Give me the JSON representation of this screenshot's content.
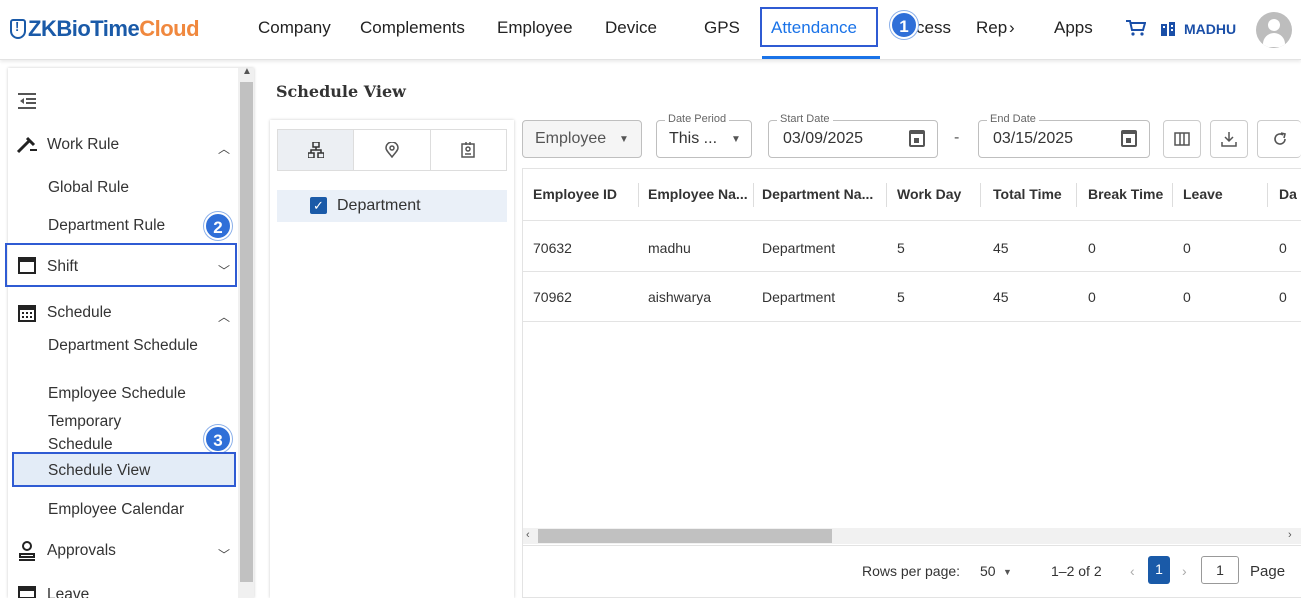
{
  "app": {
    "logo_zk": "ZKBioTime",
    "logo_cloud": "Cloud"
  },
  "nav": {
    "items": [
      "Company",
      "Complements",
      "Employee",
      "Device",
      "GPS",
      "Attendance",
      "cess",
      "Rep",
      "Apps"
    ],
    "active": "Attendance",
    "rep_arrow": "›",
    "user": "MADHU"
  },
  "badges": [
    "1",
    "2",
    "3"
  ],
  "sidebar": {
    "collapse_icon": "collapse-menu-icon",
    "work_rule": "Work Rule",
    "work_rule_items": [
      "Global Rule",
      "Department Rule"
    ],
    "shift": "Shift",
    "schedule": "Schedule",
    "schedule_items": [
      "Department Schedule",
      "Employee Schedule",
      "Temporary Schedule",
      "Schedule View",
      "Employee Calendar"
    ],
    "selected": "Schedule View",
    "approvals": "Approvals",
    "leave": "Leave"
  },
  "main": {
    "page_title": "Schedule View",
    "tree": {
      "tabs": [
        "department-tree-icon",
        "location-icon",
        "badge-icon"
      ],
      "node": "Department"
    },
    "filters": {
      "group_by": "Employee",
      "date_period_label": "Date Period",
      "date_period_value": "This ...",
      "start_date_label": "Start Date",
      "start_date": "03/09/2025",
      "end_date_label": "End Date",
      "end_date": "03/15/2025",
      "dash": "-"
    },
    "table": {
      "columns": [
        "Employee ID",
        "Employee Na...",
        "Department Na...",
        "Work Day",
        "Total Time",
        "Break Time",
        "Leave",
        "Da"
      ],
      "rows": [
        [
          "70632",
          "madhu",
          "Department",
          "5",
          "45",
          "0",
          "0",
          "0"
        ],
        [
          "70962",
          "aishwarya",
          "Department",
          "5",
          "45",
          "0",
          "0",
          "0"
        ]
      ]
    },
    "pagination": {
      "rows_per_page_label": "Rows per page:",
      "rows_per_page": "50",
      "range": "1–2 of 2",
      "current_page": "1",
      "goto_value": "1",
      "page_label": "Page"
    }
  },
  "colors": {
    "accent": "#1a73e8",
    "highlight": "#2f5bd3",
    "brand_blue": "#1a5aa8",
    "brand_orange": "#f0883e"
  }
}
